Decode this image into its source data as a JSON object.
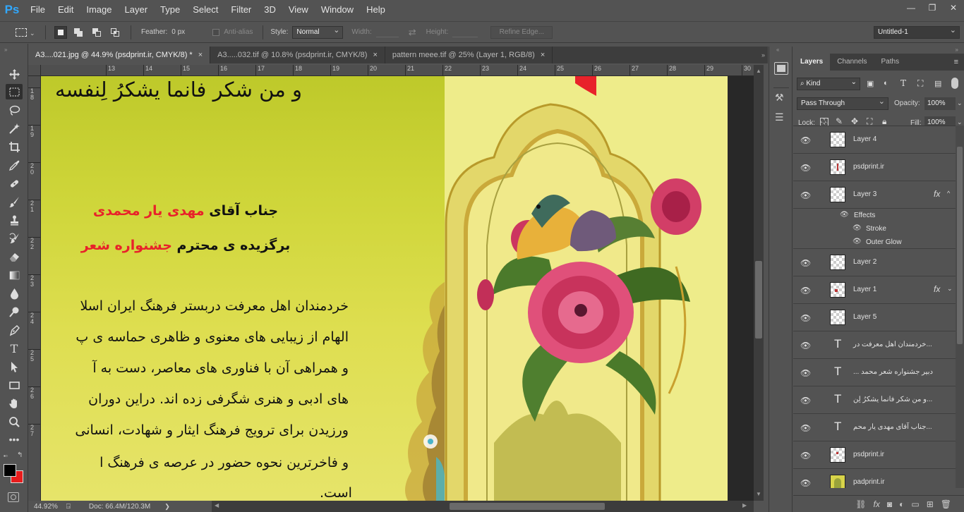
{
  "app": {
    "logo": "Ps"
  },
  "menu": [
    "File",
    "Edit",
    "Image",
    "Layer",
    "Type",
    "Select",
    "Filter",
    "3D",
    "View",
    "Window",
    "Help"
  ],
  "options": {
    "feather_label": "Feather:",
    "feather_value": "0 px",
    "antialias_label": "Anti-alias",
    "style_label": "Style:",
    "style_value": "Normal",
    "width_label": "Width:",
    "height_label": "Height:",
    "refine_edge": "Refine Edge...",
    "workspace": "Untitled-1"
  },
  "tabs": [
    {
      "label": "A3....021.jpg @ 44.9% (psdprint.ir, CMYK/8) *",
      "close": "×"
    },
    {
      "label": "A3.....032.tif @ 10.8% (psdprint.ir, CMYK/8)",
      "close": "×"
    },
    {
      "label": "pattern meee.tif @ 25% (Layer 1, RGB/8)",
      "close": "×"
    }
  ],
  "ruler_top": [
    "13",
    "14",
    "15",
    "16",
    "17",
    "18",
    "19",
    "20",
    "21",
    "22",
    "23",
    "24",
    "25",
    "26",
    "27",
    "28",
    "29",
    "30"
  ],
  "ruler_left": [
    "1\n8",
    "1\n9",
    "2\n0",
    "2\n1",
    "2\n2",
    "2\n3",
    "2\n4",
    "2\n5",
    "2\n6",
    "2\n7"
  ],
  "document": {
    "verse": "و من شکر فانما یشکرُ لِنفسه",
    "line1_black": "جناب آقای",
    "line1_red": "مهدی یار محمدی",
    "line2_black": "برگزیده ی محترم",
    "line2_red": "جشنواره شعر",
    "body": [
      "خردمندان اهل معرفت دربستر فرهنگ ایران اسلا",
      "الهام از زیبایی های معنوی و ظاهری حماسه ی پ",
      "و همراهی آن با فناوری های معاصر، دست به آ",
      "های ادبی و هنری شگرفی زده اند. دراین دوران",
      "ورزیدن برای ترویج فرهنگ ایثار و شهادت، انسانی",
      "و فاخرترین نحوه حضور در عرصه ی فرهنگ ا",
      "است."
    ]
  },
  "status": {
    "zoom": "44.92%",
    "doc": "Doc: 66.4M/120.3M"
  },
  "panel": {
    "tabs": [
      "Layers",
      "Channels",
      "Paths"
    ],
    "filter_kind": "Kind",
    "blend_mode": "Pass Through",
    "opacity_label": "Opacity:",
    "opacity_value": "100%",
    "lock_label": "Lock:",
    "fill_label": "Fill:",
    "fill_value": "100%",
    "layers": [
      {
        "name": "Layer 4",
        "kind": "pixel"
      },
      {
        "name": "psdprint.ir",
        "kind": "pixel"
      },
      {
        "name": "Layer 3",
        "kind": "pixel",
        "fx": "fx"
      },
      {
        "name": "Layer 2",
        "kind": "pixel"
      },
      {
        "name": "Layer 1",
        "kind": "pixel",
        "fx": "fx"
      },
      {
        "name": "Layer 5",
        "kind": "pixel"
      },
      {
        "name": "خردمندان اهل معرفت در...",
        "kind": "text"
      },
      {
        "name": "... دبیر جشنواره شعر محمد",
        "kind": "text"
      },
      {
        "name": "و من شکر فانما یشکرُ لِن...",
        "kind": "text"
      },
      {
        "name": "جناب آقای مهدی یار محم...",
        "kind": "text"
      },
      {
        "name": "psdprint.ir",
        "kind": "pixel"
      },
      {
        "name": "padprint.ir",
        "kind": "image"
      }
    ],
    "effects": {
      "header": "Effects",
      "items": [
        "Stroke",
        "Outer Glow"
      ]
    }
  },
  "colors": {
    "accent": "#31a8ff",
    "red": "#e8222a",
    "foreground": "#000000",
    "background": "#e81c1c"
  }
}
